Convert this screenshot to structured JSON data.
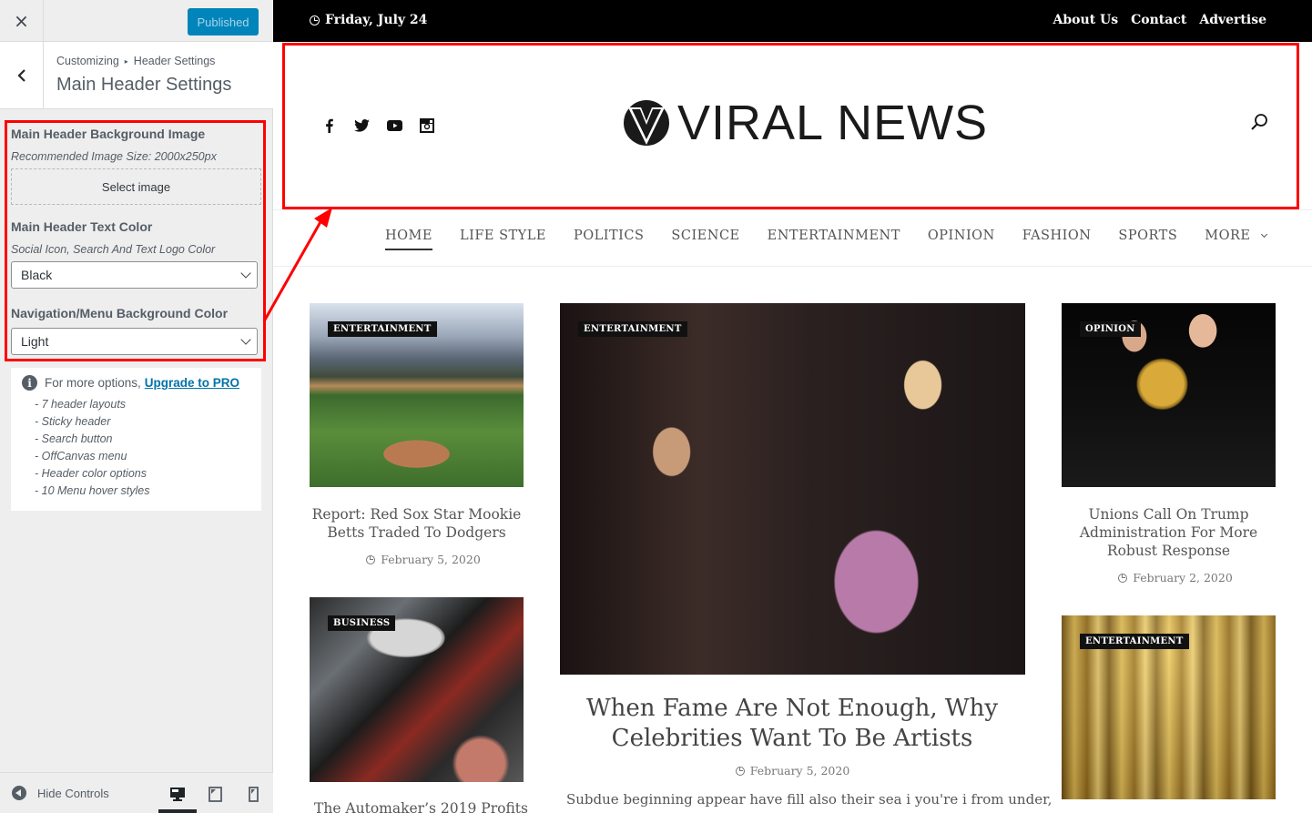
{
  "sidebar": {
    "close_label": "×",
    "publish_label": "Published",
    "breadcrumb": {
      "root": "Customizing",
      "separator": "▸",
      "section": "Header Settings"
    },
    "title": "Main Header Settings",
    "controls": {
      "bg_image": {
        "title": "Main Header Background Image",
        "description": "Recommended Image Size: 2000x250px",
        "button_label": "Select image"
      },
      "text_color": {
        "title": "Main Header Text Color",
        "description": "Social Icon, Search And Text Logo Color",
        "selected": "Black"
      },
      "nav_bg_color": {
        "title": "Navigation/Menu Background Color",
        "selected": "Light"
      }
    },
    "pro": {
      "text": "For more options,",
      "link": "Upgrade to PRO",
      "features": [
        "- 7 header layouts",
        "- Sticky header",
        "- Search button",
        "- OffCanvas menu",
        "- Header color options",
        "- 10 Menu hover styles"
      ]
    },
    "footer": {
      "hide_label": "Hide Controls",
      "devices": [
        "desktop",
        "tablet",
        "mobile"
      ],
      "active_device": "desktop"
    }
  },
  "preview": {
    "topbar": {
      "date": "Friday, July 24",
      "links": [
        "About Us",
        "Contact",
        "Advertise"
      ]
    },
    "header": {
      "social_icons": [
        "facebook-icon",
        "twitter-icon",
        "youtube-icon",
        "instagram-icon"
      ],
      "logo_text": "VIRAL NEWS",
      "search_icon": "search-icon"
    },
    "nav": {
      "items": [
        "HOME",
        "LIFE STYLE",
        "POLITICS",
        "SCIENCE",
        "ENTERTAINMENT",
        "OPINION",
        "FASHION",
        "SPORTS",
        "MORE"
      ],
      "active": "HOME"
    },
    "posts": [
      {
        "category": "ENTERTAINMENT",
        "title": "Report: Red Sox Star Mookie Betts Traded To Dodgers",
        "date": "February 5, 2020"
      },
      {
        "category": "BUSINESS",
        "title": "The Automaker’s 2019 Profits"
      },
      {
        "category": "ENTERTAINMENT",
        "title": "When Fame Are Not Enough, Why Celebrities Want To Be Artists",
        "date": "February 5, 2020",
        "excerpt": "Subdue beginning appear have fill also their sea i you're i from under,"
      },
      {
        "category": "OPINION",
        "title": "Unions Call On Trump Administration For More Robust Response",
        "date": "February 2, 2020"
      },
      {
        "category": "ENTERTAINMENT"
      }
    ]
  },
  "colors": {
    "publish_button": "#0085ba",
    "link": "#0073aa",
    "annotation": "#ff0000",
    "topbar": "#000000"
  }
}
